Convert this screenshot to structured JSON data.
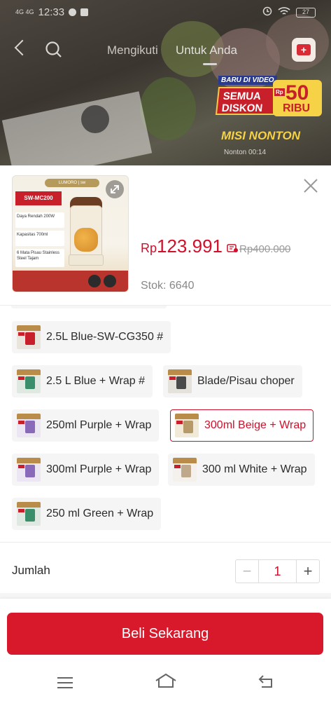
{
  "status_bar": {
    "network": "4G 4G",
    "time": "12:33",
    "battery": "27"
  },
  "top_nav": {
    "tabs": [
      {
        "label": "Mengikuti"
      },
      {
        "label": "Untuk Anda"
      }
    ]
  },
  "promo": {
    "tag": "BARU DI VIDEO",
    "headline": "SEMUA DISKON",
    "currency": "Rp",
    "amount": "50",
    "unit": "RIBU",
    "mission": "MISI NONTON",
    "timer": "Nonton 00:14"
  },
  "product": {
    "image_text": {
      "brand": "LUMORO | sw",
      "model": "SW-MC200",
      "power": "Daya Rendah 200W",
      "capacity": "Kapasitas 700ml",
      "blades": "6 Mata Pisau Stainless Steel Tajam"
    },
    "price_currency": "Rp",
    "price": "123.991",
    "original_price": "Rp400.000",
    "stock": "Stok: 6640"
  },
  "variants": [
    {
      "label": "2.5L Blue-SW-CG350 #",
      "selected": false,
      "thumb": "blender"
    },
    {
      "label": "2.5 L Blue + Wrap  #",
      "selected": false,
      "thumb": "blender-green"
    },
    {
      "label": "Blade/Pisau choper",
      "selected": false,
      "thumb": "blade"
    },
    {
      "label": "250ml Purple  + Wrap",
      "selected": false,
      "thumb": "blender-purple"
    },
    {
      "label": "300ml Beige  +  Wrap",
      "selected": true,
      "thumb": "blender-beige"
    },
    {
      "label": "300ml Purple + Wrap",
      "selected": false,
      "thumb": "blender-purple"
    },
    {
      "label": "300 ml White + Wrap",
      "selected": false,
      "thumb": "blender-white"
    },
    {
      "label": "250 ml Green + Wrap",
      "selected": false,
      "thumb": "blender-green"
    }
  ],
  "quantity": {
    "label": "Jumlah",
    "value": "1",
    "minus": "−",
    "plus": "+"
  },
  "buy_button": {
    "label": "Beli Sekarang"
  },
  "colors": {
    "accent": "#d0102b",
    "button": "#d8192b"
  }
}
